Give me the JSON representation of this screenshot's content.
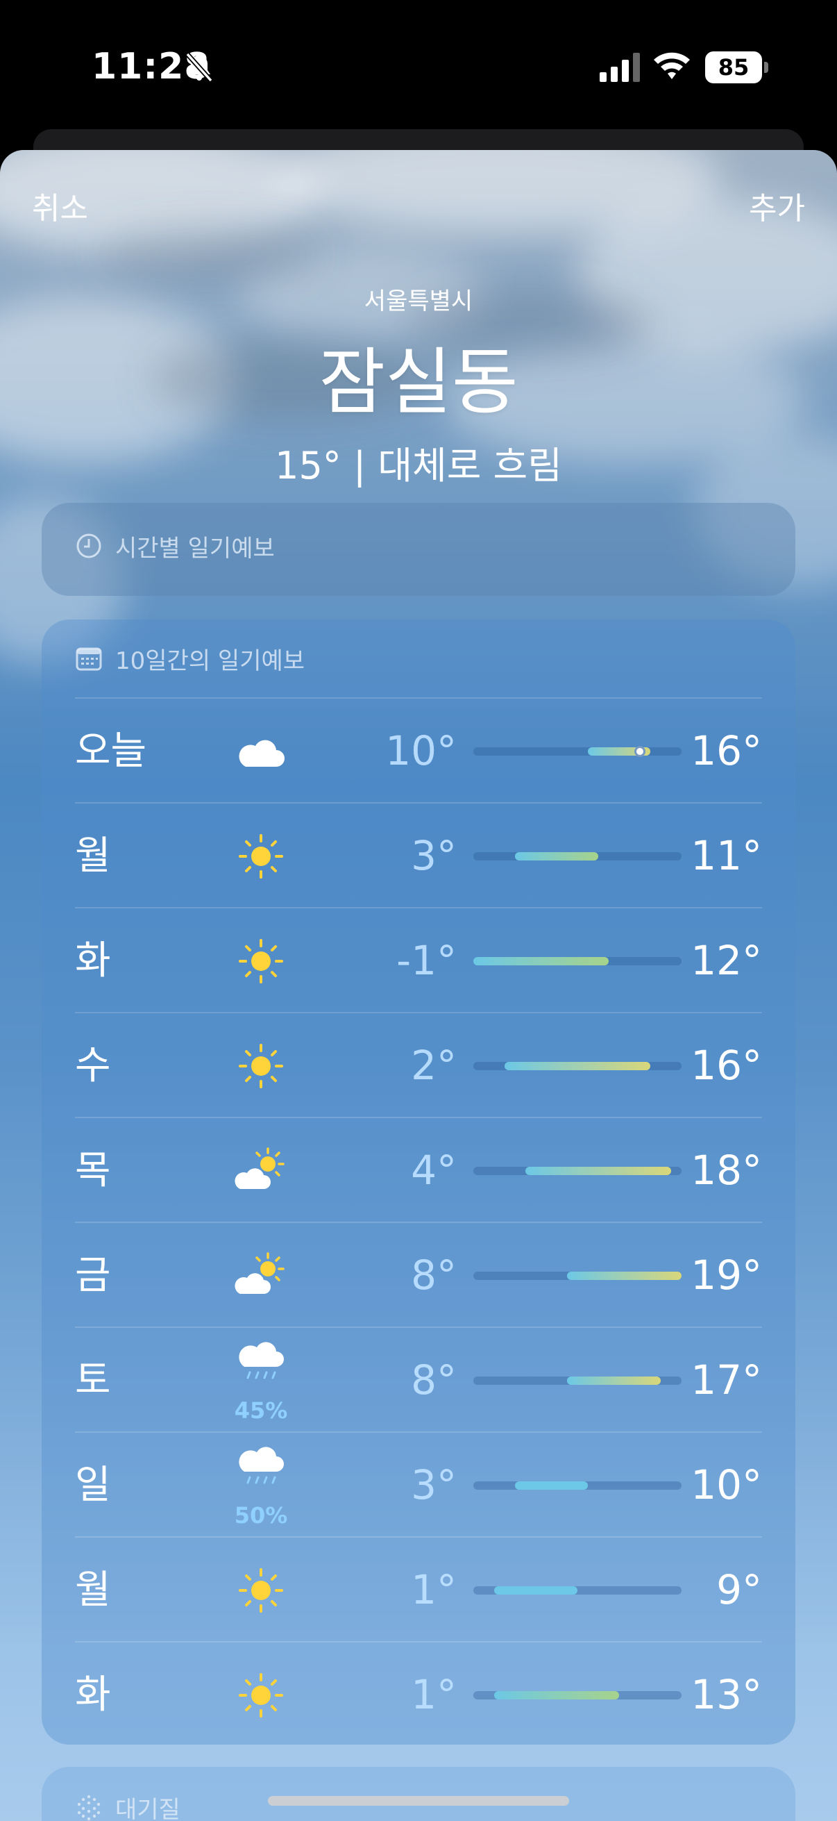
{
  "status_bar": {
    "time": "11:28",
    "battery": "85",
    "icons": [
      "bell-slash-icon",
      "cellular-signal-icon",
      "wifi-icon",
      "battery-icon"
    ]
  },
  "nav": {
    "cancel_label": "취소",
    "add_label": "추가"
  },
  "location": {
    "region": "서울특별시",
    "name": "잠실동",
    "condition": "15° | 대체로 흐림"
  },
  "hourly": {
    "title": "시간별 일기예보",
    "icon": "clock-icon"
  },
  "daily": {
    "title": "10일간의 일기예보",
    "icon": "calendar-icon",
    "scale_min": -1,
    "scale_max": 19,
    "current_temp": 15,
    "days": [
      {
        "day": "오늘",
        "icon": "cloud-icon",
        "low": "10°",
        "high": "16°",
        "low_value": 10,
        "high_value": 16,
        "pop": ""
      },
      {
        "day": "월",
        "icon": "sun-icon",
        "low": "3°",
        "high": "11°",
        "low_value": 3,
        "high_value": 11,
        "pop": ""
      },
      {
        "day": "화",
        "icon": "sun-icon",
        "low": "-1°",
        "high": "12°",
        "low_value": -1,
        "high_value": 12,
        "pop": ""
      },
      {
        "day": "수",
        "icon": "sun-icon",
        "low": "2°",
        "high": "16°",
        "low_value": 2,
        "high_value": 16,
        "pop": ""
      },
      {
        "day": "목",
        "icon": "partly-cloudy-icon",
        "low": "4°",
        "high": "18°",
        "low_value": 4,
        "high_value": 18,
        "pop": ""
      },
      {
        "day": "금",
        "icon": "partly-cloudy-icon",
        "low": "8°",
        "high": "19°",
        "low_value": 8,
        "high_value": 19,
        "pop": ""
      },
      {
        "day": "토",
        "icon": "rain-icon",
        "low": "8°",
        "high": "17°",
        "low_value": 8,
        "high_value": 17,
        "pop": "45%"
      },
      {
        "day": "일",
        "icon": "rain-icon",
        "low": "3°",
        "high": "10°",
        "low_value": 3,
        "high_value": 10,
        "pop": "50%"
      },
      {
        "day": "월",
        "icon": "sun-icon",
        "low": "1°",
        "high": "9°",
        "low_value": 1,
        "high_value": 9,
        "pop": ""
      },
      {
        "day": "화",
        "icon": "sun-icon",
        "low": "1°",
        "high": "13°",
        "low_value": 1,
        "high_value": 13,
        "pop": ""
      }
    ]
  },
  "air_quality": {
    "title": "대기질",
    "icon": "air-quality-icon"
  },
  "colors": {
    "cool": "#6cc8e6",
    "mild": "#a7d38b",
    "warm": "#d9d77a"
  }
}
